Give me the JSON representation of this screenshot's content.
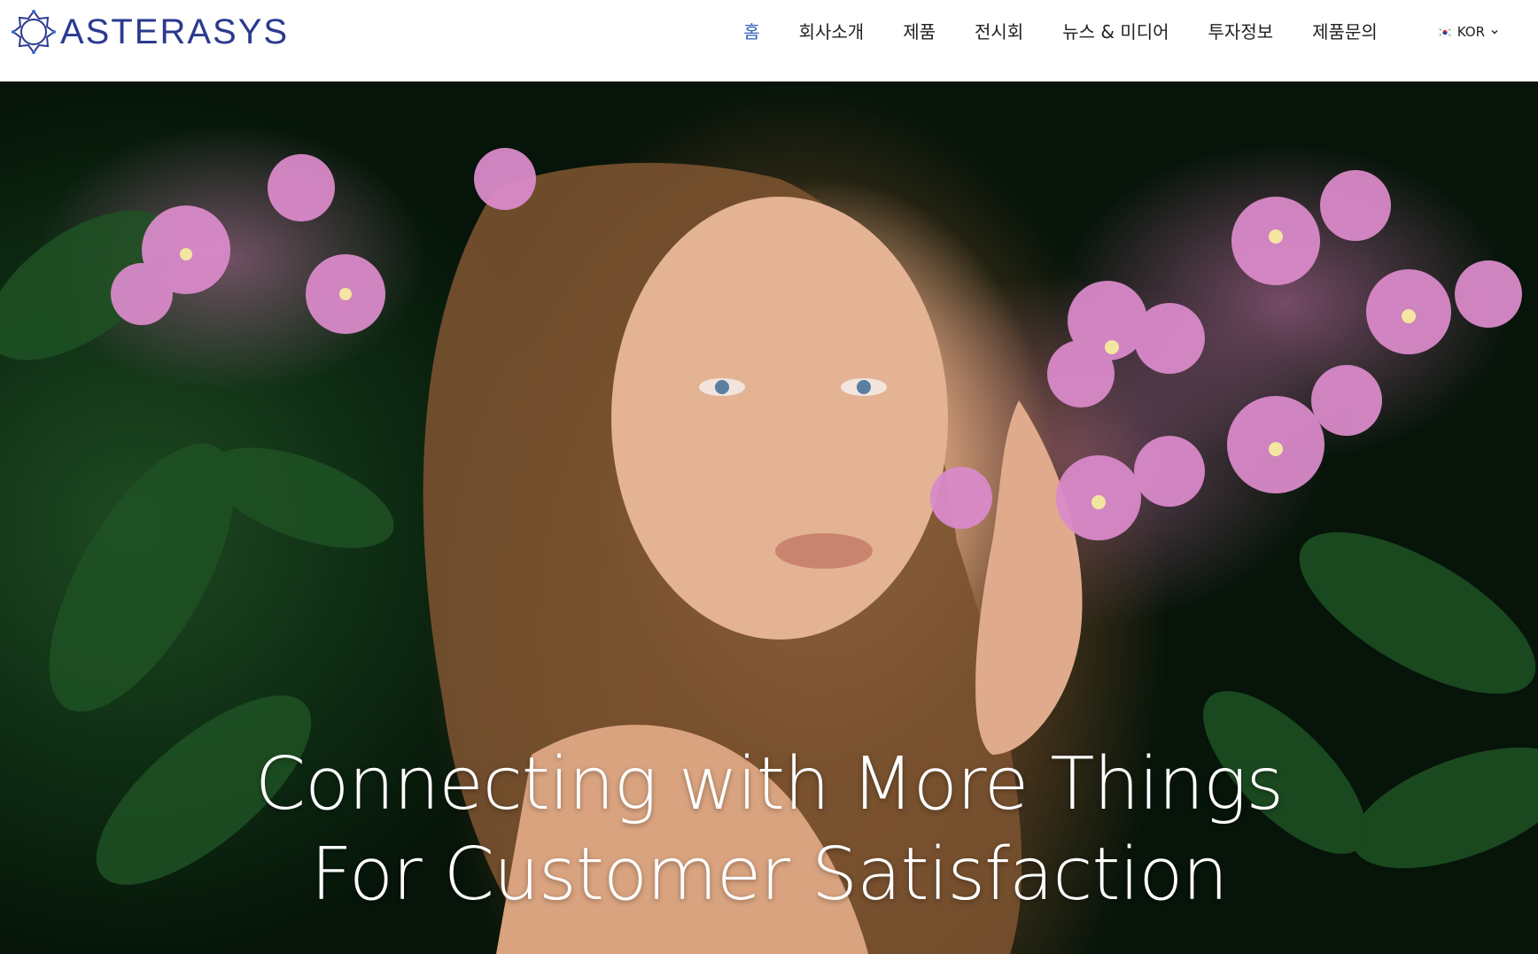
{
  "header": {
    "logo_text": "ASTERASYS",
    "nav": [
      {
        "label": "홈",
        "active": true
      },
      {
        "label": "회사소개",
        "active": false
      },
      {
        "label": "제품",
        "active": false
      },
      {
        "label": "전시회",
        "active": false
      },
      {
        "label": "뉴스 & 미디어",
        "active": false
      },
      {
        "label": "투자정보",
        "active": false
      },
      {
        "label": "제품문의",
        "active": false
      }
    ],
    "language": {
      "label": "KOR",
      "flag_icon": "korea-flag-icon"
    }
  },
  "hero": {
    "headline_line1": "Connecting with More Things",
    "headline_line2": "For Customer Satisfaction"
  },
  "colors": {
    "brand": "#2b3a8f",
    "nav_active": "#2f63b9",
    "nav_text": "#222222"
  }
}
